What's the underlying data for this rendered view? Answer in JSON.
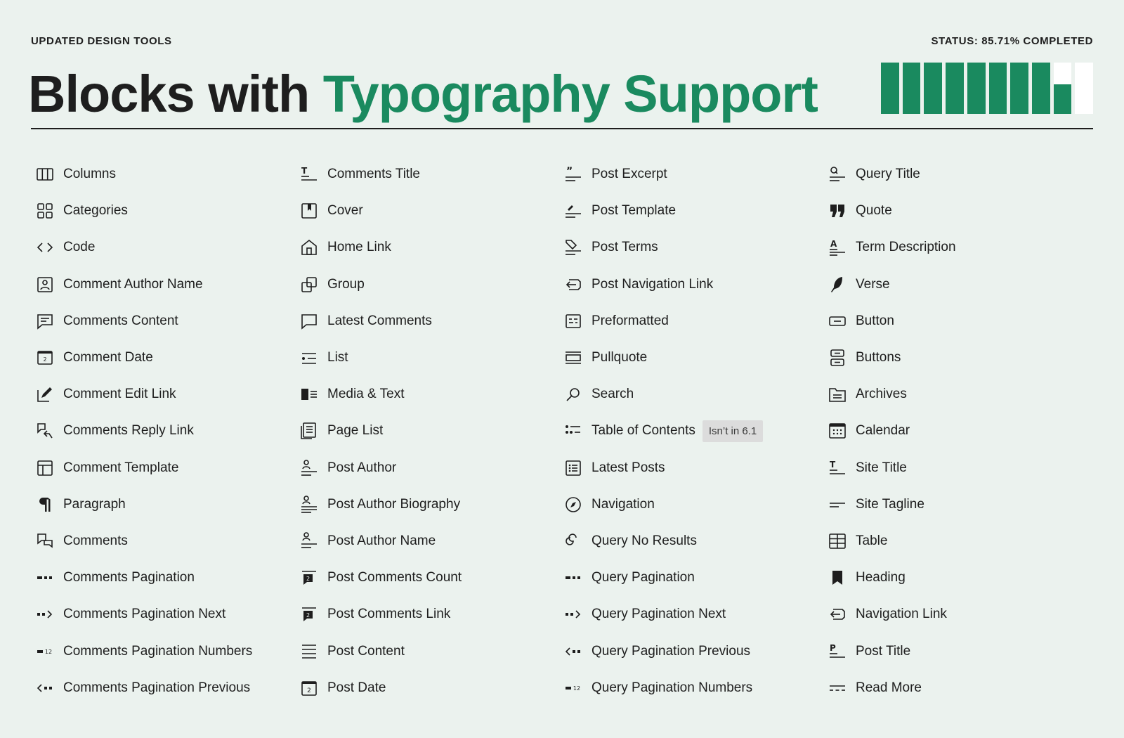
{
  "header": {
    "eyebrow": "UPDATED DESIGN TOOLS",
    "status": "STATUS: 85.71% COMPLETED",
    "title_plain": "Blocks with",
    "title_accent": "Typography Support",
    "accent_color": "#1a8a5f",
    "progress_percent": 85.71,
    "progress_segments": 10
  },
  "columns": [
    [
      {
        "label": "Columns",
        "icon": "columns-icon"
      },
      {
        "label": "Categories",
        "icon": "categories-icon"
      },
      {
        "label": "Code",
        "icon": "code-icon"
      },
      {
        "label": "Comment Author Name",
        "icon": "comment-author-name-icon"
      },
      {
        "label": "Comments Content",
        "icon": "comments-content-icon"
      },
      {
        "label": "Comment Date",
        "icon": "comment-date-icon"
      },
      {
        "label": "Comment Edit Link",
        "icon": "comment-edit-link-icon"
      },
      {
        "label": "Comments Reply Link",
        "icon": "comments-reply-link-icon"
      },
      {
        "label": "Comment Template",
        "icon": "comment-template-icon"
      },
      {
        "label": "Paragraph",
        "icon": "paragraph-icon"
      },
      {
        "label": "Comments",
        "icon": "comments-icon"
      },
      {
        "label": "Comments Pagination",
        "icon": "comments-pagination-icon"
      },
      {
        "label": "Comments Pagination Next",
        "icon": "comments-pagination-next-icon"
      },
      {
        "label": "Comments Pagination Numbers",
        "icon": "comments-pagination-numbers-icon"
      },
      {
        "label": "Comments Pagination Previous",
        "icon": "comments-pagination-previous-icon"
      }
    ],
    [
      {
        "label": "Comments Title",
        "icon": "comments-title-icon"
      },
      {
        "label": "Cover",
        "icon": "cover-icon"
      },
      {
        "label": "Home Link",
        "icon": "home-link-icon"
      },
      {
        "label": "Group",
        "icon": "group-icon"
      },
      {
        "label": "Latest Comments",
        "icon": "latest-comments-icon"
      },
      {
        "label": "List",
        "icon": "list-icon"
      },
      {
        "label": "Media & Text",
        "icon": "media-text-icon"
      },
      {
        "label": "Page List",
        "icon": "page-list-icon"
      },
      {
        "label": "Post Author",
        "icon": "post-author-icon"
      },
      {
        "label": "Post Author Biography",
        "icon": "post-author-biography-icon"
      },
      {
        "label": "Post Author Name",
        "icon": "post-author-name-icon"
      },
      {
        "label": "Post Comments Count",
        "icon": "post-comments-count-icon"
      },
      {
        "label": "Post Comments Link",
        "icon": "post-comments-link-icon"
      },
      {
        "label": "Post Content",
        "icon": "post-content-icon"
      },
      {
        "label": "Post Date",
        "icon": "post-date-icon"
      }
    ],
    [
      {
        "label": "Post Excerpt",
        "icon": "post-excerpt-icon"
      },
      {
        "label": "Post Template",
        "icon": "post-template-icon"
      },
      {
        "label": "Post Terms",
        "icon": "post-terms-icon"
      },
      {
        "label": "Post Navigation Link",
        "icon": "post-navigation-link-icon"
      },
      {
        "label": "Preformatted",
        "icon": "preformatted-icon"
      },
      {
        "label": "Pullquote",
        "icon": "pullquote-icon"
      },
      {
        "label": "Search",
        "icon": "search-icon"
      },
      {
        "label": "Table of Contents",
        "icon": "table-of-contents-icon",
        "badge": "Isn’t in 6.1"
      },
      {
        "label": "Latest Posts",
        "icon": "latest-posts-icon"
      },
      {
        "label": "Navigation",
        "icon": "navigation-icon"
      },
      {
        "label": "Query No Results",
        "icon": "query-no-results-icon"
      },
      {
        "label": "Query Pagination",
        "icon": "query-pagination-icon"
      },
      {
        "label": "Query Pagination Next",
        "icon": "query-pagination-next-icon"
      },
      {
        "label": "Query Pagination Previous",
        "icon": "query-pagination-previous-icon"
      },
      {
        "label": "Query Pagination Numbers",
        "icon": "query-pagination-numbers-icon"
      }
    ],
    [
      {
        "label": "Query Title",
        "icon": "query-title-icon"
      },
      {
        "label": "Quote",
        "icon": "quote-icon"
      },
      {
        "label": "Term Description",
        "icon": "term-description-icon"
      },
      {
        "label": "Verse",
        "icon": "verse-icon"
      },
      {
        "label": "Button",
        "icon": "button-icon"
      },
      {
        "label": "Buttons",
        "icon": "buttons-icon"
      },
      {
        "label": "Archives",
        "icon": "archives-icon"
      },
      {
        "label": "Calendar",
        "icon": "calendar-icon"
      },
      {
        "label": "Site Title",
        "icon": "site-title-icon"
      },
      {
        "label": "Site Tagline",
        "icon": "site-tagline-icon"
      },
      {
        "label": "Table",
        "icon": "table-icon"
      },
      {
        "label": "Heading",
        "icon": "heading-icon"
      },
      {
        "label": "Navigation Link",
        "icon": "navigation-link-icon"
      },
      {
        "label": "Post Title",
        "icon": "post-title-icon"
      },
      {
        "label": "Read More",
        "icon": "read-more-icon"
      }
    ]
  ]
}
